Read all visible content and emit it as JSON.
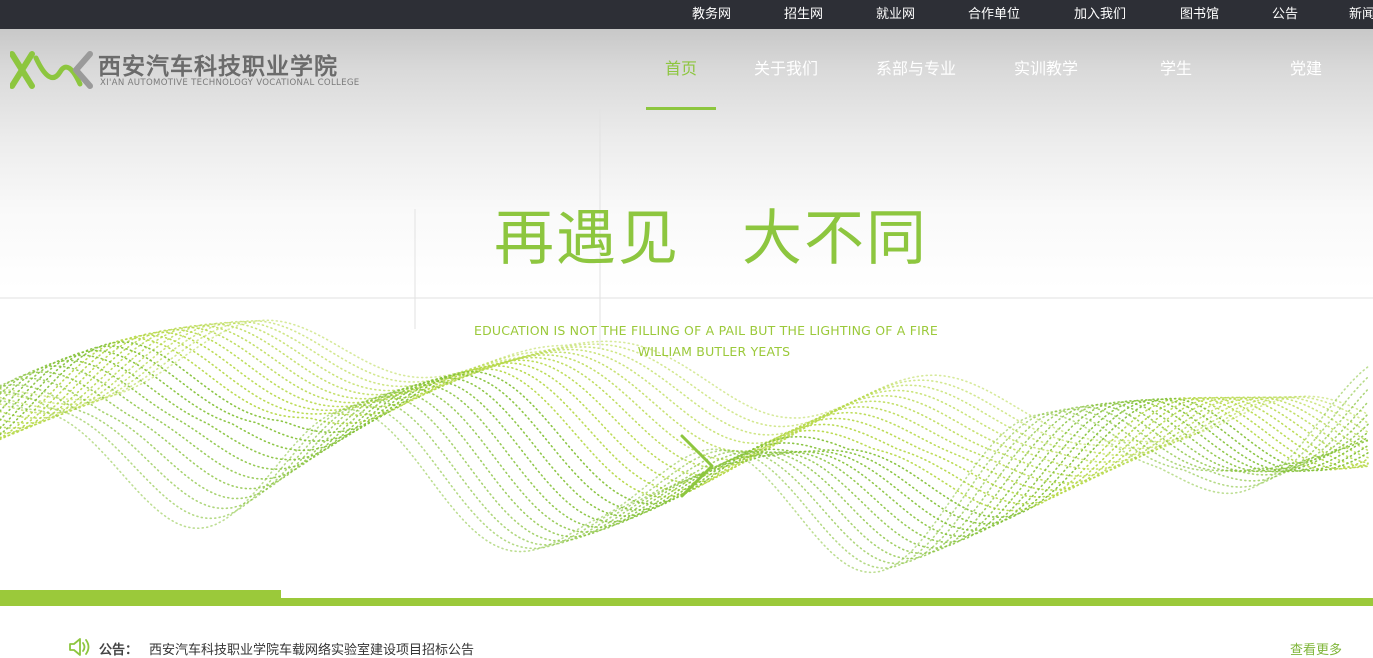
{
  "top_links": [
    "教务网",
    "招生网",
    "就业网",
    "合作单位",
    "加入我们",
    "图书馆",
    "公告",
    "新闻"
  ],
  "logo": {
    "name_cn": "西安汽车科技职业学院",
    "name_en": "XI'AN AUTOMOTIVE TECHNOLOGY VOCATIONAL COLLEGE"
  },
  "nav": {
    "items": [
      "首页",
      "关于我们",
      "系部与专业",
      "实训教学",
      "学生",
      "党建"
    ],
    "active": "首页"
  },
  "hero": {
    "slogan": "再遇见　大不同",
    "quote_line1": "EDUCATION IS NOT THE FILLING OF A PAIL BUT THE LIGHTING OF A FIRE",
    "quote_line2": "WILLIAM BUTLER YEATS",
    "next_icon": "chevron-right-icon",
    "progress": 0.205
  },
  "notice": {
    "icon": "speaker-icon",
    "label": "公告：",
    "text": "西安汽车科技职业学院车载网络实验室建设项目招标公告",
    "more": "查看更多"
  },
  "colors": {
    "topbar": "#2d2f36",
    "accent_green": "#8dc63f",
    "wave_green": "#9bc93a"
  }
}
